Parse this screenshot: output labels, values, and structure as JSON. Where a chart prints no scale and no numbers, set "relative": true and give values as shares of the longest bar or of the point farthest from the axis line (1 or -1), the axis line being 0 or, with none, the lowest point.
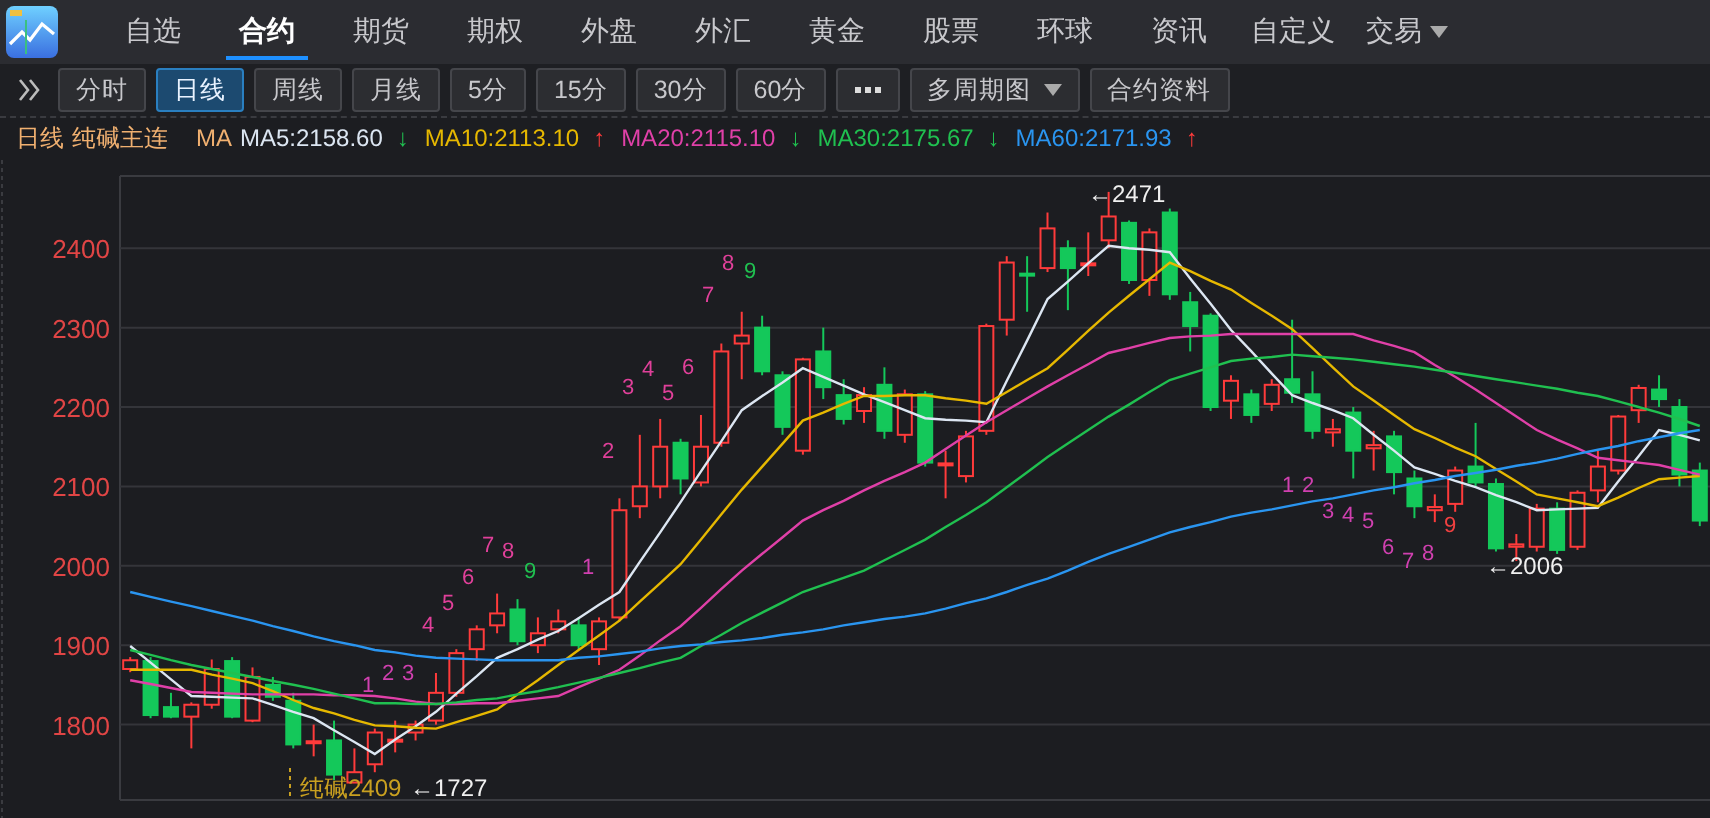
{
  "nav": {
    "tabs": [
      {
        "label": "自选",
        "selected": false,
        "has_menu": false
      },
      {
        "label": "合约",
        "selected": true,
        "has_menu": false
      },
      {
        "label": "期货",
        "selected": false,
        "has_menu": false
      },
      {
        "label": "期权",
        "selected": false,
        "has_menu": false
      },
      {
        "label": "外盘",
        "selected": false,
        "has_menu": false
      },
      {
        "label": "外汇",
        "selected": false,
        "has_menu": false
      },
      {
        "label": "黄金",
        "selected": false,
        "has_menu": false
      },
      {
        "label": "股票",
        "selected": false,
        "has_menu": false
      },
      {
        "label": "环球",
        "selected": false,
        "has_menu": false
      },
      {
        "label": "资讯",
        "selected": false,
        "has_menu": false
      },
      {
        "label": "自定义",
        "selected": false,
        "has_menu": false
      },
      {
        "label": "交易",
        "selected": false,
        "has_menu": true
      }
    ]
  },
  "toolbar": {
    "buttons": [
      {
        "kind": "button",
        "label": "分时",
        "selected": false
      },
      {
        "kind": "button",
        "label": "日线",
        "selected": true
      },
      {
        "kind": "button",
        "label": "周线",
        "selected": false
      },
      {
        "kind": "button",
        "label": "月线",
        "selected": false
      },
      {
        "kind": "button",
        "label": "5分",
        "selected": false
      },
      {
        "kind": "button",
        "label": "15分",
        "selected": false
      },
      {
        "kind": "button",
        "label": "30分",
        "selected": false
      },
      {
        "kind": "button",
        "label": "60分",
        "selected": false
      },
      {
        "kind": "more",
        "selected": false
      },
      {
        "kind": "menu",
        "label": "多周期图",
        "selected": false
      },
      {
        "kind": "button",
        "label": "合约资料",
        "selected": false
      }
    ]
  },
  "legend": {
    "period": "日线",
    "contract": "纯碱主连",
    "prefix": "MA",
    "ma_values": [
      {
        "value": ":2158.60",
        "arrow": {
          "text": "↓",
          "color": "#20c050"
        }
      },
      {
        "value": ":2113.10",
        "arrow": {
          "text": "↑",
          "color": "#ff3b3b"
        }
      },
      {
        "value": ":2115.10",
        "arrow": {
          "text": "↓",
          "color": "#20c050"
        }
      },
      {
        "value": ":2175.67",
        "arrow": {
          "text": "↓",
          "color": "#20c050"
        }
      },
      {
        "value": ":2171.93",
        "arrow": {
          "text": "↑",
          "color": "#ff3b3b"
        }
      }
    ]
  },
  "chart": {
    "candles": {
      "chart_data": {
        "type": "candlestick",
        "grid": true,
        "categories": [
          null,
          null,
          null,
          null,
          null,
          null,
          null,
          null,
          null,
          null,
          null,
          null,
          null,
          null,
          null,
          null,
          null,
          null,
          null,
          null,
          null,
          null,
          null,
          null,
          null,
          null,
          null,
          null,
          null,
          null,
          null,
          null,
          null,
          null,
          null,
          null,
          null,
          null,
          null,
          null,
          null,
          null,
          null,
          null,
          null,
          null,
          null,
          null,
          null,
          null,
          null,
          null,
          null,
          null,
          null,
          null,
          null,
          null,
          null,
          null,
          null,
          null,
          null,
          null,
          null,
          null,
          null,
          null,
          null,
          null,
          null,
          null,
          null,
          null,
          null,
          null,
          null,
          null
        ],
        "ylim": [
          1705,
          2491
        ],
        "yticks": [
          {
            "value": 2400,
            "label": "2400"
          },
          {
            "value": 2300,
            "label": "2300"
          },
          {
            "value": 2200,
            "label": "2200"
          },
          {
            "value": 2100,
            "label": "2100"
          },
          {
            "value": 2000,
            "label": "2000"
          },
          {
            "value": 1900,
            "label": "1900"
          },
          {
            "value": 1800,
            "label": "1800"
          }
        ],
        "ohlc": [
          [
            1870,
            1885,
            1866,
            1881
          ],
          [
            1880,
            1885,
            1808,
            1812
          ],
          [
            1822,
            1840,
            1808,
            1810
          ],
          [
            1810,
            1828,
            1770,
            1825
          ],
          [
            1825,
            1882,
            1820,
            1870
          ],
          [
            1880,
            1885,
            1808,
            1810
          ],
          [
            1805,
            1872,
            1803,
            1860
          ],
          [
            1850,
            1860,
            1830,
            1835
          ],
          [
            1830,
            1840,
            1770,
            1775
          ],
          [
            1777,
            1800,
            1760,
            1779
          ],
          [
            1780,
            1805,
            1730,
            1737
          ],
          [
            1727,
            1770,
            1727,
            1740
          ],
          [
            1750,
            1795,
            1740,
            1790
          ],
          [
            1779,
            1805,
            1765,
            1781
          ],
          [
            1790,
            1805,
            1780,
            1800
          ],
          [
            1805,
            1865,
            1800,
            1840
          ],
          [
            1840,
            1895,
            1835,
            1890
          ],
          [
            1895,
            1925,
            1880,
            1920
          ],
          [
            1925,
            1965,
            1915,
            1940
          ],
          [
            1945,
            1958,
            1900,
            1905
          ],
          [
            1900,
            1935,
            1890,
            1915
          ],
          [
            1920,
            1945,
            1915,
            1930
          ],
          [
            1925,
            1935,
            1895,
            1900
          ],
          [
            1895,
            1935,
            1875,
            1930
          ],
          [
            1935,
            2085,
            1930,
            2070
          ],
          [
            2075,
            2165,
            2060,
            2100
          ],
          [
            2100,
            2185,
            2085,
            2150
          ],
          [
            2155,
            2160,
            2090,
            2110
          ],
          [
            2105,
            2190,
            2100,
            2150
          ],
          [
            2155,
            2280,
            2150,
            2270
          ],
          [
            2280,
            2320,
            2235,
            2290
          ],
          [
            2300,
            2315,
            2240,
            2245
          ],
          [
            2240,
            2245,
            2165,
            2175
          ],
          [
            2145,
            2262,
            2140,
            2260
          ],
          [
            2270,
            2300,
            2210,
            2225
          ],
          [
            2215,
            2235,
            2178,
            2185
          ],
          [
            2195,
            2225,
            2180,
            2215
          ],
          [
            2228,
            2250,
            2160,
            2170
          ],
          [
            2165,
            2222,
            2155,
            2216
          ],
          [
            2216,
            2220,
            2125,
            2130
          ],
          [
            2127,
            2145,
            2085,
            2129
          ],
          [
            2113,
            2170,
            2105,
            2163
          ],
          [
            2170,
            2305,
            2165,
            2302
          ],
          [
            2310,
            2390,
            2290,
            2382
          ],
          [
            2368,
            2390,
            2320,
            2366
          ],
          [
            2375,
            2445,
            2370,
            2425
          ],
          [
            2400,
            2410,
            2322,
            2375
          ],
          [
            2379,
            2420,
            2365,
            2381
          ],
          [
            2410,
            2471,
            2400,
            2440
          ],
          [
            2432,
            2435,
            2355,
            2360
          ],
          [
            2360,
            2425,
            2340,
            2420
          ],
          [
            2445,
            2450,
            2335,
            2342
          ],
          [
            2332,
            2345,
            2270,
            2302
          ],
          [
            2315,
            2318,
            2195,
            2200
          ],
          [
            2208,
            2240,
            2185,
            2233
          ],
          [
            2216,
            2222,
            2180,
            2190
          ],
          [
            2204,
            2235,
            2195,
            2228
          ],
          [
            2235,
            2310,
            2205,
            2218
          ],
          [
            2216,
            2245,
            2160,
            2170
          ],
          [
            2168,
            2185,
            2150,
            2172
          ],
          [
            2193,
            2200,
            2110,
            2145
          ],
          [
            2148,
            2170,
            2120,
            2152
          ],
          [
            2163,
            2170,
            2090,
            2118
          ],
          [
            2110,
            2120,
            2060,
            2075
          ],
          [
            2070,
            2090,
            2055,
            2074
          ],
          [
            2078,
            2125,
            2068,
            2120
          ],
          [
            2125,
            2180,
            2100,
            2105
          ],
          [
            2103,
            2110,
            2018,
            2022
          ],
          [
            2024,
            2040,
            2006,
            2027
          ],
          [
            2024,
            2078,
            2018,
            2072
          ],
          [
            2072,
            2080,
            2015,
            2020
          ],
          [
            2024,
            2095,
            2020,
            2092
          ],
          [
            2095,
            2145,
            2080,
            2125
          ],
          [
            2120,
            2190,
            2115,
            2188
          ],
          [
            2196,
            2228,
            2180,
            2224
          ],
          [
            2222,
            2240,
            2200,
            2210
          ],
          [
            2200,
            2210,
            2100,
            2115
          ],
          [
            2120,
            2130,
            2050,
            2057
          ]
        ]
      }
    },
    "moving_averages": {
      "chart_data": {
        "type": "line",
        "relative": true,
        "ylim": [
          1705,
          2491
        ],
        "categories": [
          null,
          null,
          null,
          null,
          null,
          null,
          null,
          null,
          null,
          null,
          null,
          null,
          null,
          null,
          null,
          null,
          null,
          null,
          null,
          null,
          null,
          null,
          null,
          null,
          null,
          null,
          null,
          null,
          null,
          null,
          null,
          null,
          null,
          null,
          null,
          null,
          null,
          null,
          null,
          null,
          null,
          null,
          null,
          null,
          null,
          null,
          null,
          null,
          null,
          null,
          null,
          null,
          null,
          null,
          null,
          null,
          null,
          null,
          null,
          null,
          null,
          null,
          null,
          null,
          null,
          null,
          null,
          null,
          null,
          null,
          null,
          null,
          null,
          null,
          null,
          null,
          null,
          null
        ],
        "series": [
          {
            "name": "MA5",
            "color": "#dce6f2",
            "values": [
              1899,
              1878,
              1857,
              1836,
              1835,
              1834,
              1833,
              1825,
              1816,
              1808,
              1793,
              1778,
              1763,
              1781,
              1798,
              1816,
              1839,
              1861,
              1884,
              1895,
              1907,
              1918,
              1934,
              1951,
              1967,
              2005,
              2042,
              2080,
              2119,
              2157,
              2196,
              2214,
              2231,
              2249,
              2238,
              2227,
              2216,
              2206,
              2196,
              2186,
              2184,
              2183,
              2181,
              2233,
              2284,
              2336,
              2358,
              2381,
              2403,
              2400,
              2398,
              2395,
              2362,
              2330,
              2297,
              2270,
              2242,
              2215,
              2205,
              2196,
              2186,
              2165,
              2145,
              2124,
              2116,
              2107,
              2099,
              2089,
              2080,
              2070,
              2071,
              2072,
              2073,
              2106,
              2138,
              2171,
              2165,
              2158
            ]
          },
          {
            "name": "MA10",
            "color": "#e6b800",
            "values": [
              1869,
              1869,
              1869,
              1869,
              1863,
              1858,
              1852,
              1842,
              1831,
              1821,
              1814,
              1806,
              1799,
              1798,
              1796,
              1795,
              1803,
              1811,
              1819,
              1838,
              1856,
              1875,
              1894,
              1912,
              1931,
              1955,
              1978,
              2002,
              2033,
              2065,
              2096,
              2125,
              2154,
              2183,
              2193,
              2204,
              2214,
              2214,
              2215,
              2215,
              2211,
              2208,
              2204,
              2219,
              2234,
              2249,
              2272,
              2296,
              2319,
              2340,
              2361,
              2382,
              2371,
              2359,
              2348,
              2331,
              2315,
              2298,
              2274,
              2250,
              2226,
              2208,
              2190,
              2172,
              2161,
              2149,
              2138,
              2122,
              2106,
              2090,
              2085,
              2080,
              2075,
              2086,
              2098,
              2109,
              2111,
              2113
            ]
          },
          {
            "name": "MA20",
            "color": "#e040a8",
            "values": [
              1856,
              1851,
              1846,
              1841,
              1840,
              1839,
              1838,
              1838,
              1838,
              1838,
              1837,
              1837,
              1836,
              1833,
              1829,
              1826,
              1826,
              1827,
              1827,
              1830,
              1833,
              1836,
              1847,
              1858,
              1869,
              1887,
              1906,
              1924,
              1947,
              1971,
              1994,
              2015,
              2036,
              2057,
              2070,
              2082,
              2095,
              2107,
              2118,
              2130,
              2147,
              2164,
              2181,
              2196,
              2211,
              2226,
              2240,
              2254,
              2268,
              2274,
              2281,
              2287,
              2289,
              2290,
              2292,
              2292,
              2292,
              2292,
              2292,
              2292,
              2292,
              2284,
              2277,
              2269,
              2253,
              2238,
              2222,
              2205,
              2188,
              2171,
              2159,
              2148,
              2136,
              2133,
              2130,
              2127,
              2121,
              2115
            ]
          },
          {
            "name": "MA30",
            "color": "#20c050",
            "values": [
              1894,
              1888,
              1881,
              1875,
              1870,
              1865,
              1860,
              1855,
              1850,
              1845,
              1839,
              1833,
              1827,
              1827,
              1826,
              1826,
              1828,
              1831,
              1833,
              1838,
              1842,
              1847,
              1853,
              1859,
              1865,
              1871,
              1878,
              1884,
              1899,
              1913,
              1928,
              1941,
              1954,
              1967,
              1976,
              1985,
              1994,
              2007,
              2020,
              2033,
              2049,
              2064,
              2080,
              2099,
              2118,
              2137,
              2154,
              2171,
              2188,
              2203,
              2219,
              2234,
              2242,
              2250,
              2258,
              2261,
              2263,
              2266,
              2264,
              2262,
              2260,
              2257,
              2254,
              2251,
              2247,
              2243,
              2239,
              2235,
              2231,
              2227,
              2223,
              2218,
              2214,
              2207,
              2200,
              2193,
              2185,
              2176
            ]
          },
          {
            "name": "MA60",
            "color": "#2a95f0",
            "values": [
              1967,
              1961,
              1955,
              1949,
              1943,
              1937,
              1931,
              1924,
              1918,
              1911,
              1905,
              1900,
              1894,
              1891,
              1887,
              1884,
              1883,
              1882,
              1881,
              1881,
              1881,
              1881,
              1884,
              1886,
              1889,
              1892,
              1896,
              1899,
              1901,
              1904,
              1906,
              1909,
              1913,
              1916,
              1920,
              1925,
              1929,
              1933,
              1936,
              1940,
              1946,
              1953,
              1959,
              1967,
              1976,
              1984,
              1994,
              2005,
              2015,
              2024,
              2033,
              2042,
              2049,
              2055,
              2062,
              2067,
              2071,
              2076,
              2081,
              2085,
              2090,
              2095,
              2099,
              2104,
              2108,
              2113,
              2117,
              2121,
              2126,
              2130,
              2135,
              2141,
              2146,
              2151,
              2157,
              2162,
              2167,
              2171
            ]
          }
        ]
      }
    },
    "count_marks": [
      {
        "text": "1",
        "color": "#d040b0"
      },
      {
        "text": "2",
        "color": "#d040b0"
      },
      {
        "text": "3",
        "color": "#d040b0"
      },
      {
        "text": "4",
        "color": "#e0409a"
      },
      {
        "text": "5",
        "color": "#e0409a"
      },
      {
        "text": "6",
        "color": "#e0409a"
      },
      {
        "text": "7",
        "color": "#e0409a"
      },
      {
        "text": "8",
        "color": "#e0409a"
      },
      {
        "text": "9",
        "color": "#20c050"
      },
      {
        "text": "1",
        "color": "#d040b0"
      },
      {
        "text": "2",
        "color": "#e0409a"
      },
      {
        "text": "3",
        "color": "#e0409a"
      },
      {
        "text": "4",
        "color": "#e0409a"
      },
      {
        "text": "5",
        "color": "#e0409a"
      },
      {
        "text": "6",
        "color": "#e0409a"
      },
      {
        "text": "7",
        "color": "#e0409a"
      },
      {
        "text": "8",
        "color": "#e0409a"
      },
      {
        "text": "9",
        "color": "#20c050"
      },
      {
        "text": "1",
        "color": "#d040b0"
      },
      {
        "text": "2",
        "color": "#d040b0"
      },
      {
        "text": "3",
        "color": "#d040b0"
      },
      {
        "text": "4",
        "color": "#d040b0"
      },
      {
        "text": "5",
        "color": "#d040b0"
      },
      {
        "text": "6",
        "color": "#d040b0"
      },
      {
        "text": "7",
        "color": "#d040b0"
      },
      {
        "text": "8",
        "color": "#d040b0"
      },
      {
        "text": "9",
        "color": "#f04040"
      }
    ],
    "price_marks": [
      "←2471",
      "←2006",
      "←1727"
    ],
    "contract_label": "纯碱2409"
  }
}
